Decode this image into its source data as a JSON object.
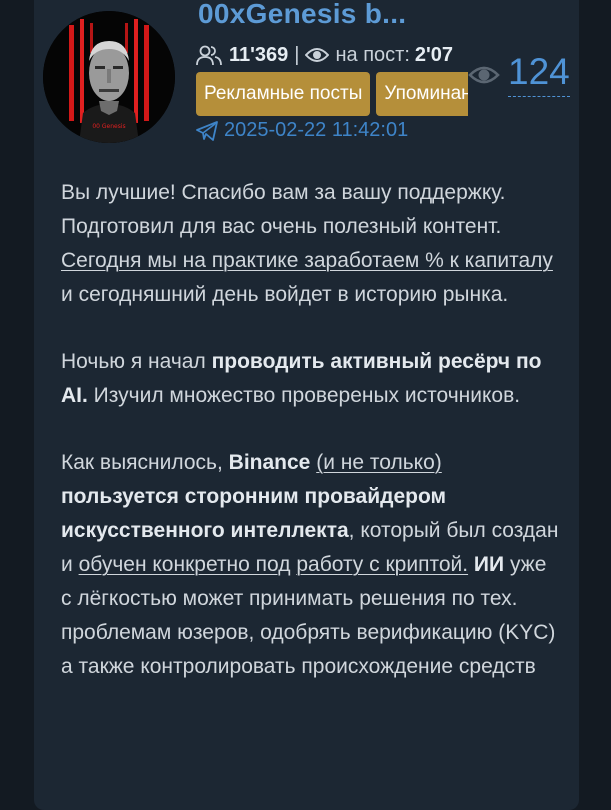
{
  "channel": {
    "title": "00xGenesis b...",
    "subscribers": "11'369",
    "reach_label": "на пост:",
    "reach_value": "2'07",
    "avatar_caption": "00 Genesis"
  },
  "buttons": [
    "Рекламные посты",
    "Упоминания"
  ],
  "post": {
    "views": "124",
    "date": "2025-02-22 11:42:01",
    "paragraphs": [
      [
        {
          "t": "Вы лучшие! Спасибо вам за вашу поддержку. Подготовил для вас очень полезный контент. "
        },
        {
          "t": "Сегодня мы на практике заработаем % к капиталу",
          "s": "u"
        },
        {
          "t": " и сегодняшний день войдет в историю рынка."
        }
      ],
      [
        {
          "t": "Ночью я начал "
        },
        {
          "t": "проводить активный ресёрч по AI.",
          "s": "b"
        },
        {
          "t": " Изучил множество провереных источников."
        }
      ],
      [
        {
          "t": "Как выяснилось, "
        },
        {
          "t": "Binance",
          "s": "b"
        },
        {
          "t": " "
        },
        {
          "t": "(и не только)",
          "s": "u"
        },
        {
          "t": " "
        },
        {
          "t": "пользуется сторонним провайдером искусственного интеллекта",
          "s": "b"
        },
        {
          "t": ", который был создан и "
        },
        {
          "t": "обучен конкретно под",
          "s": "u"
        },
        {
          "t": " "
        },
        {
          "t": "работу с криптой.",
          "s": "u"
        },
        {
          "t": " "
        },
        {
          "t": "ИИ",
          "s": "b"
        },
        {
          "t": " уже с лёгкостью может принимать решения по тех. проблемам юзеров, одобрять верификацию (KYC) а также контролировать происхождение средств"
        }
      ]
    ]
  },
  "colors": {
    "page_bg": "#131a22",
    "card_bg": "#1c2733",
    "title": "#5d9bd6",
    "button_bg": "#b58f3a",
    "link": "#3e84c8"
  }
}
